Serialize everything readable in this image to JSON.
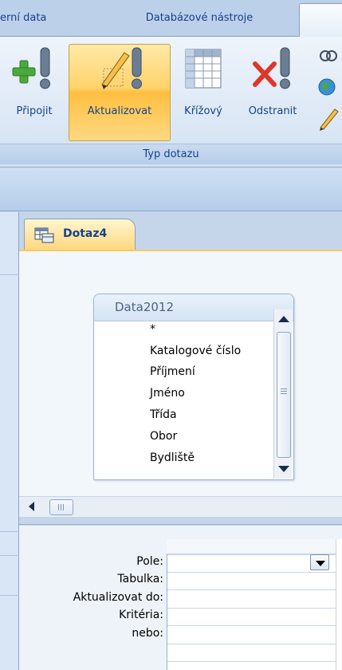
{
  "tabs": {
    "first": "erní data",
    "second": "Databázové nástroje"
  },
  "ribbon": {
    "buttons": {
      "pripojit": "Připojit",
      "aktualizovat": "Aktualizovat",
      "krizovy": "Křížový",
      "odstranit": "Odstranit"
    },
    "group_label": "Typ dotazu"
  },
  "document": {
    "tab_label": "Dotaz4"
  },
  "table": {
    "title": "Data2012",
    "fields": [
      "*",
      "Katalogové číslo",
      "Příjmení",
      "Jméno",
      "Třída",
      "Obor",
      "Bydliště"
    ]
  },
  "grid": {
    "row_labels": [
      "Pole:",
      "Tabulka:",
      "Aktualizovat do:",
      "Kritéria:",
      "nebo:"
    ]
  },
  "colors": {
    "accent": "#15428b",
    "highlight": "#ffd36b"
  }
}
